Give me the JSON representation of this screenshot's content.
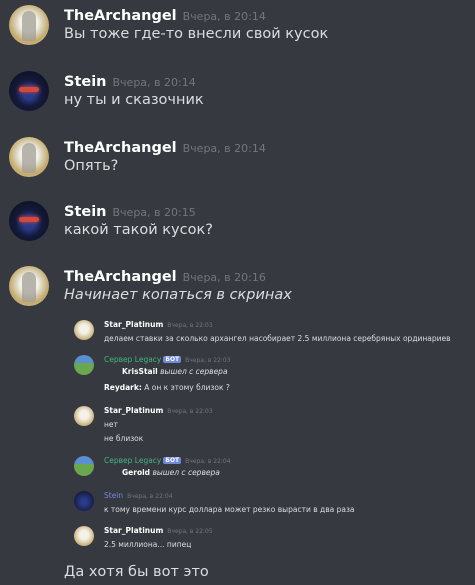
{
  "messages": [
    {
      "author": "TheArchangel",
      "time": "Вчера, в 20:14",
      "text": "Вы тоже где-то внесли свой кусок"
    },
    {
      "author": "Stein",
      "time": "Вчера, в 20:14",
      "text": "ну ты и сказочник"
    },
    {
      "author": "TheArchangel",
      "time": "Вчера, в 20:14",
      "text": "Опять?"
    },
    {
      "author": "Stein",
      "time": "Вчера, в 20:15",
      "text": "какой такой кусок?"
    },
    {
      "author": "TheArchangel",
      "time": "Вчера, в 20:16",
      "text": "Начинает копаться в скринах",
      "text2": "Да хотя бы вот это"
    }
  ],
  "embed": {
    "m1": {
      "author": "Star_Platinum",
      "time": "Вчера, в 22:03",
      "text": "делаем ставки за сколько архангел насобирает 2.5 миллиона серебряных ординариев"
    },
    "m2": {
      "author": "Сервер Legacy",
      "badge": "БОТ",
      "time": "Вчера, в 22:03",
      "user": "KrisStail",
      "action": "вышел с сервера",
      "reply_user": "Reydark:",
      "reply_text": "А он к этому близок ?"
    },
    "m3": {
      "author": "Star_Platinum",
      "time": "Вчера, в 22:03",
      "line1": "нет",
      "line2": "не близок"
    },
    "m4": {
      "author": "Сервер Legacy",
      "badge": "БОТ",
      "time": "Вчера, в 22:04",
      "user": "Gerold",
      "action": "вышел с сервера"
    },
    "m5": {
      "author": "Stein",
      "time": "Вчера, в 22:04",
      "text": "к тому времени курс доллара может резко вырасти в два раза"
    },
    "m6": {
      "author": "Star_Platinum",
      "time": "Вчера, в 22:05",
      "text": "2.5  миллиона... пипец"
    }
  },
  "colors": {
    "background": "#36393f",
    "username": "#ffffff",
    "text": "#dcddde",
    "timestamp": "#72767d",
    "bot_green": "#43b581",
    "stein_blue": "#7289da"
  },
  "icons": {
    "archangel_avatar": "archangel-avatar",
    "stein_avatar": "stein-avatar",
    "legacy_avatar": "legacy-server-avatar"
  }
}
